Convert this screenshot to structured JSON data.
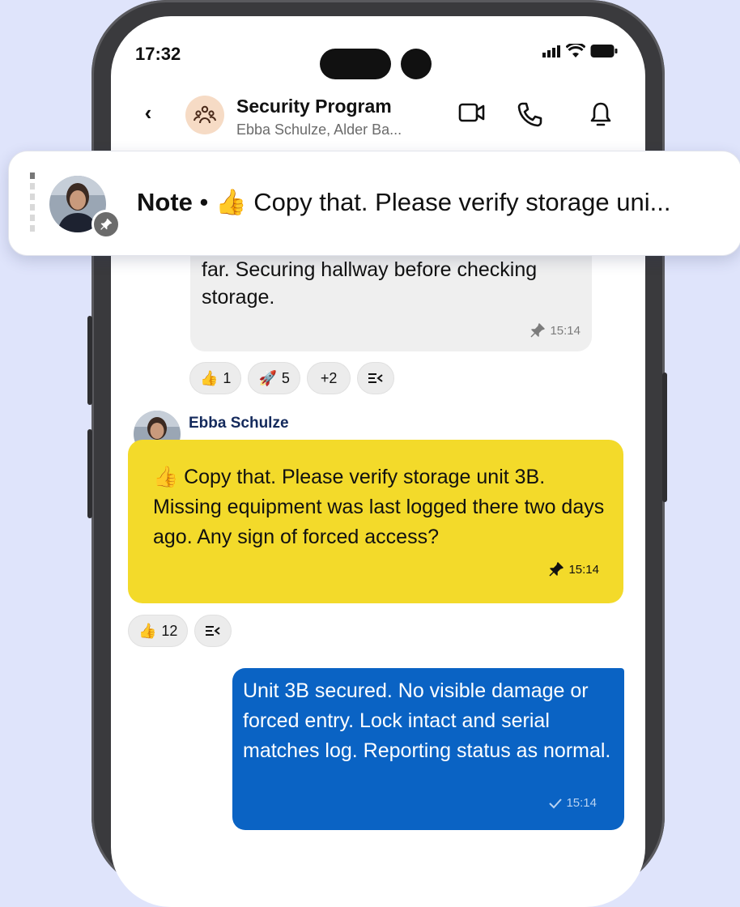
{
  "status_bar": {
    "time": "17:32"
  },
  "header": {
    "back_label": "‹",
    "title": "Security Program",
    "subtitle": "Ebba Schulze, Alder Ba..."
  },
  "pinned_note": {
    "label": "Note",
    "separator": "•",
    "emoji": "👍",
    "text": "Copy that. Please verify storage uni..."
  },
  "messages": {
    "prev": {
      "text": "far. Securing hallway before checking storage.",
      "time": "15:14",
      "reactions": [
        {
          "emoji": "👍",
          "count": "1"
        },
        {
          "emoji": "🚀",
          "count": "5"
        },
        {
          "emoji": "",
          "count": "+2"
        }
      ]
    },
    "note": {
      "sender": "Ebba Schulze",
      "emoji": "👍",
      "text": "Copy that. Please verify storage unit 3B. Missing equipment was last logged there two days ago. Any sign of forced access?",
      "time": "15:14",
      "reactions": [
        {
          "emoji": "👍",
          "count": "12"
        }
      ]
    },
    "outgoing": {
      "text": "Unit 3B secured. No visible damage or forced entry. Lock intact and serial matches log. Reporting status as normal.",
      "time": "15:14"
    }
  },
  "colors": {
    "background": "#dfe4fb",
    "note_bubble": "#f3da2a",
    "outgoing_bubble": "#0a63c4",
    "sender_name": "#142a5c"
  },
  "icons": [
    "video-call-icon",
    "phone-icon",
    "bell-icon",
    "pin-icon",
    "thread-icon",
    "check-icon",
    "group-icon"
  ]
}
